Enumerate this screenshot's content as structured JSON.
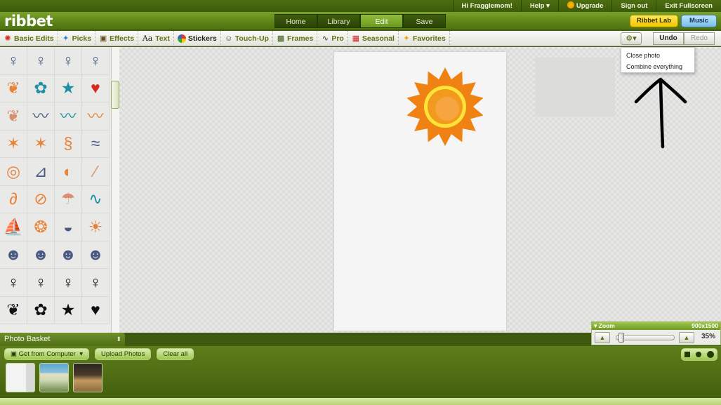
{
  "topbar": {
    "greeting": "Hi Fragglemom!",
    "help": "Help ▾",
    "upgrade": "Upgrade",
    "signout": "Sign out",
    "fullscreen": "Exit Fullscreen"
  },
  "header": {
    "logo": "ribbet",
    "tabs": [
      {
        "label": "Home"
      },
      {
        "label": "Library"
      },
      {
        "label": "Edit"
      },
      {
        "label": "Save"
      }
    ],
    "active_tab": "Edit",
    "ribbet_lab": "Ribbet Lab",
    "music": "Music"
  },
  "toolbar": {
    "items": [
      {
        "label": "Basic Edits",
        "icon": "sparkle-icon"
      },
      {
        "label": "Picks",
        "icon": "pin-icon"
      },
      {
        "label": "Effects",
        "icon": "film-icon"
      },
      {
        "label": "Text",
        "icon": "text-icon"
      },
      {
        "label": "Stickers",
        "icon": "palette-icon"
      },
      {
        "label": "Touch-Up",
        "icon": "face-icon"
      },
      {
        "label": "Frames",
        "icon": "frame-icon"
      },
      {
        "label": "Pro",
        "icon": "curve-icon"
      },
      {
        "label": "Seasonal",
        "icon": "calendar-icon"
      },
      {
        "label": "Favorites",
        "icon": "star-icon"
      }
    ],
    "active_item": "Stickers",
    "gear_label": "⚙▾",
    "undo": "Undo",
    "redo": "Redo"
  },
  "dropdown": {
    "items": [
      "Close photo",
      "Combine everything"
    ]
  },
  "stickers": {
    "colors": {
      "navy": "#4a5a82",
      "orange": "#e8833a",
      "teal": "#1f8fa6",
      "red": "#d8291e",
      "black": "#111111",
      "salmon": "#d98f6e"
    },
    "rows": [
      [
        "woman-figure-icon",
        "woman-figure-icon",
        "woman-figure-icon",
        "woman-figure-icon"
      ],
      [
        "butterfly-icon",
        "flower-icon",
        "star-icon",
        "heart-icon"
      ],
      [
        "butterfly-icon",
        "seagull-icon",
        "seagull-icon",
        "seagull-icon"
      ],
      [
        "starfish-icon",
        "starfish-icon",
        "seahorse-icon",
        "swimmer-icon"
      ],
      [
        "life-ring-icon",
        "beach-chair-icon",
        "beach-ball-icon",
        "popsicle-icon"
      ],
      [
        "flip-flop-icon",
        "surfboard-icon",
        "beach-umbrella-icon",
        "wave-icon"
      ],
      [
        "sailboat-icon",
        "seashell-icon",
        "whale-icon",
        "sun-icon"
      ],
      [
        "face-icon",
        "face-icon",
        "face-icon",
        "face-icon"
      ],
      [
        "woman-figure-icon",
        "woman-figure-icon",
        "woman-figure-icon",
        "woman-figure-icon"
      ],
      [
        "butterfly-icon",
        "flower-icon",
        "star-icon",
        "heart-icon"
      ]
    ]
  },
  "zoom": {
    "label": "Zoom",
    "dimensions": "900x1500",
    "percent": "35%",
    "level": 0.05
  },
  "basket": {
    "title": "Photo Basket",
    "get_from_computer": "Get from Computer",
    "upload_photos": "Upload Photos",
    "clear_all": "Clear all"
  }
}
